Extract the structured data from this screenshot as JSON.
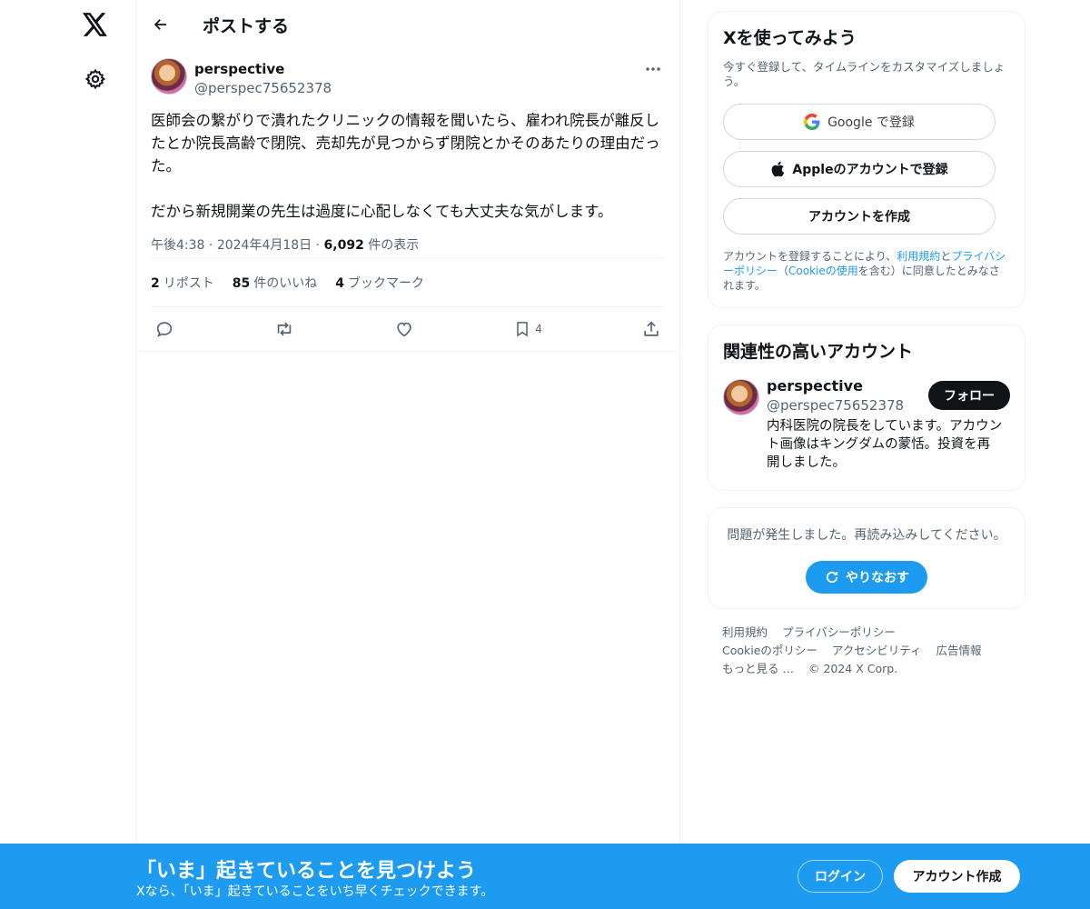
{
  "header": {
    "title": "ポストする"
  },
  "post": {
    "author_name": "perspective",
    "author_handle": "@perspec75652378",
    "text": "医師会の繋がりで潰れたクリニックの情報を聞いたら、雇われ院長が離反したとか院長高齢で閉院、売却先が見つからず閉院とかそのあたりの理由だった。\n\nだから新規開業の先生は過度に心配しなくても大丈夫な気がします。",
    "time": "午後4:38",
    "date": "2024年4月18日",
    "views_count": "6,092",
    "views_label": "件の表示",
    "reposts_count": "2",
    "reposts_label": "リポスト",
    "likes_count": "85",
    "likes_label": "件のいいね",
    "bookmarks_count": "4",
    "bookmarks_label": "ブックマーク",
    "bookmark_action_count": "4"
  },
  "signup_card": {
    "title": "Xを使ってみよう",
    "subtitle": "今すぐ登録して、タイムラインをカスタマイズしましょう。",
    "google_label": "Google で登録",
    "apple_label": "Appleのアカウントで登録",
    "create_label": "アカウントを作成",
    "terms_prefix": "アカウントを登録することにより、",
    "terms_link": "利用規約",
    "terms_and": "と",
    "privacy_link": "プライバシーポリシー",
    "terms_mid": "（",
    "cookie_link": "Cookieの使用",
    "terms_suffix": "を含む）に同意したとみなされます。"
  },
  "related": {
    "title": "関連性の高いアカウント",
    "name": "perspective",
    "handle": "@perspec75652378",
    "follow_label": "フォロー",
    "bio": "内科医院の院長をしています。アカウント画像はキングダムの蒙恬。投資を再開しました。"
  },
  "error_card": {
    "text": "問題が発生しました。再読み込みしてください。",
    "retry_label": "やりなおす"
  },
  "footer": {
    "terms": "利用規約",
    "privacy": "プライバシーポリシー",
    "cookie": "Cookieのポリシー",
    "accessibility": "アクセシビリティ",
    "ads": "広告情報",
    "more": "もっと見る …",
    "copyright": "© 2024 X Corp."
  },
  "banner": {
    "title": "「いま」起きていることを見つけよう",
    "subtitle": "Xなら、「いま」起きていることをいち早くチェックできます。",
    "login_label": "ログイン",
    "signup_label": "アカウント作成"
  },
  "colors": {
    "accent": "#1d9bf0",
    "text": "#0f1419",
    "muted": "#536471"
  }
}
